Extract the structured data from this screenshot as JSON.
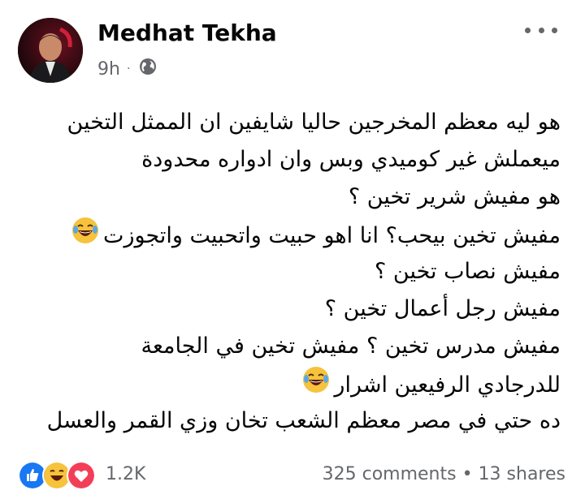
{
  "post": {
    "author": "Medhat Tekha",
    "time": "9h",
    "separator": "·",
    "lines": [
      "هو ليه معظم المخرجين حاليا شايفين ان الممثل  التخين",
      "ميعملش غير كوميدي وبس وان ادواره محدودة",
      "هو مفيش شرير تخين ؟",
      "مفيش تخين بيحب؟ انا اهو حبيت واتحبيت  واتجوزت",
      "مفيش نصاب تخين ؟",
      "مفيش رجل أعمال تخين ؟",
      "مفيش مدرس تخين ؟ مفيش تخين في الجامعة",
      "للدرجادي الرفيعين اشرار",
      "ده حتي في مصر معظم الشعب تخان وزي القمر والعسل"
    ]
  },
  "footer": {
    "reaction_count": "1.2K",
    "comments": "325 comments",
    "dot": "•",
    "shares": "13 shares"
  },
  "icons": {
    "globe": "globe-icon",
    "more": "more-options-icon",
    "laugh": "laughing-emoji"
  }
}
